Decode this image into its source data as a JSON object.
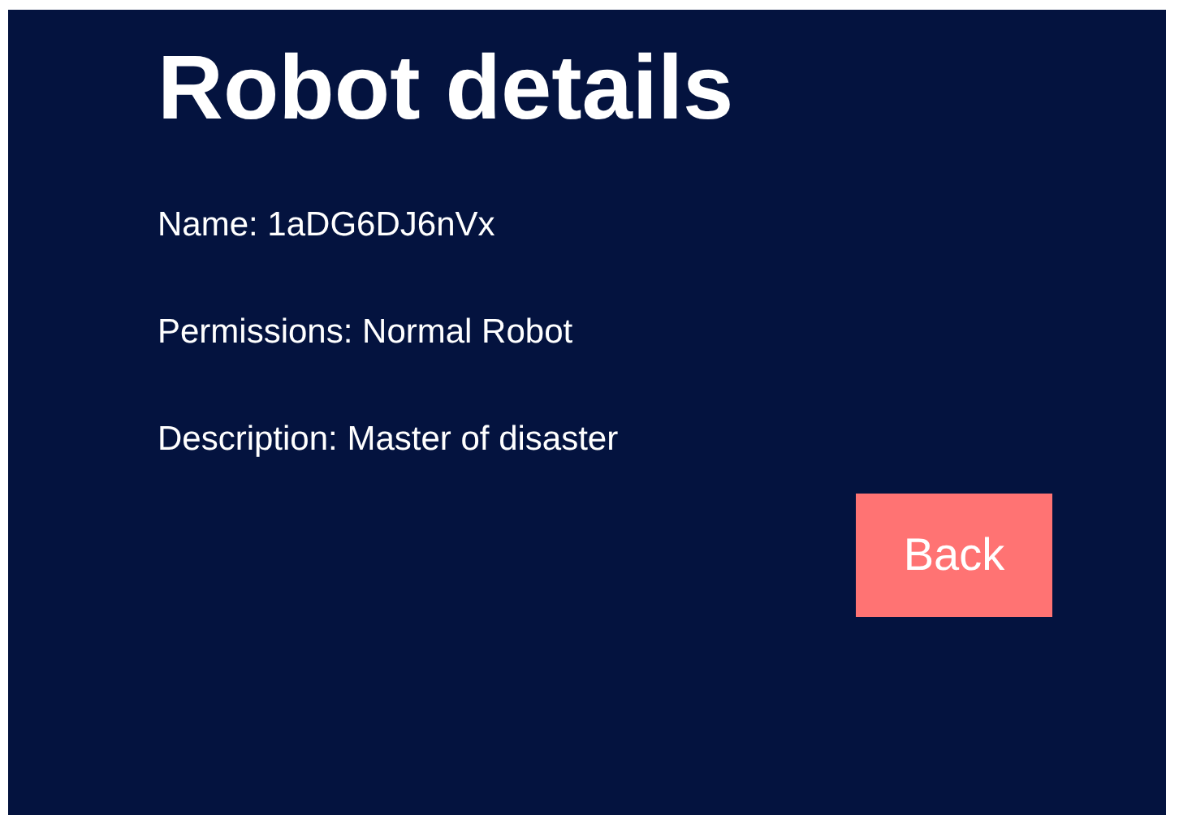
{
  "title": "Robot details",
  "fields": [
    {
      "text": "Name: 1aDG6DJ6nVx"
    },
    {
      "text": "Permissions: Normal Robot"
    },
    {
      "text": "Description: Master of disaster"
    }
  ],
  "back_button": "Back"
}
